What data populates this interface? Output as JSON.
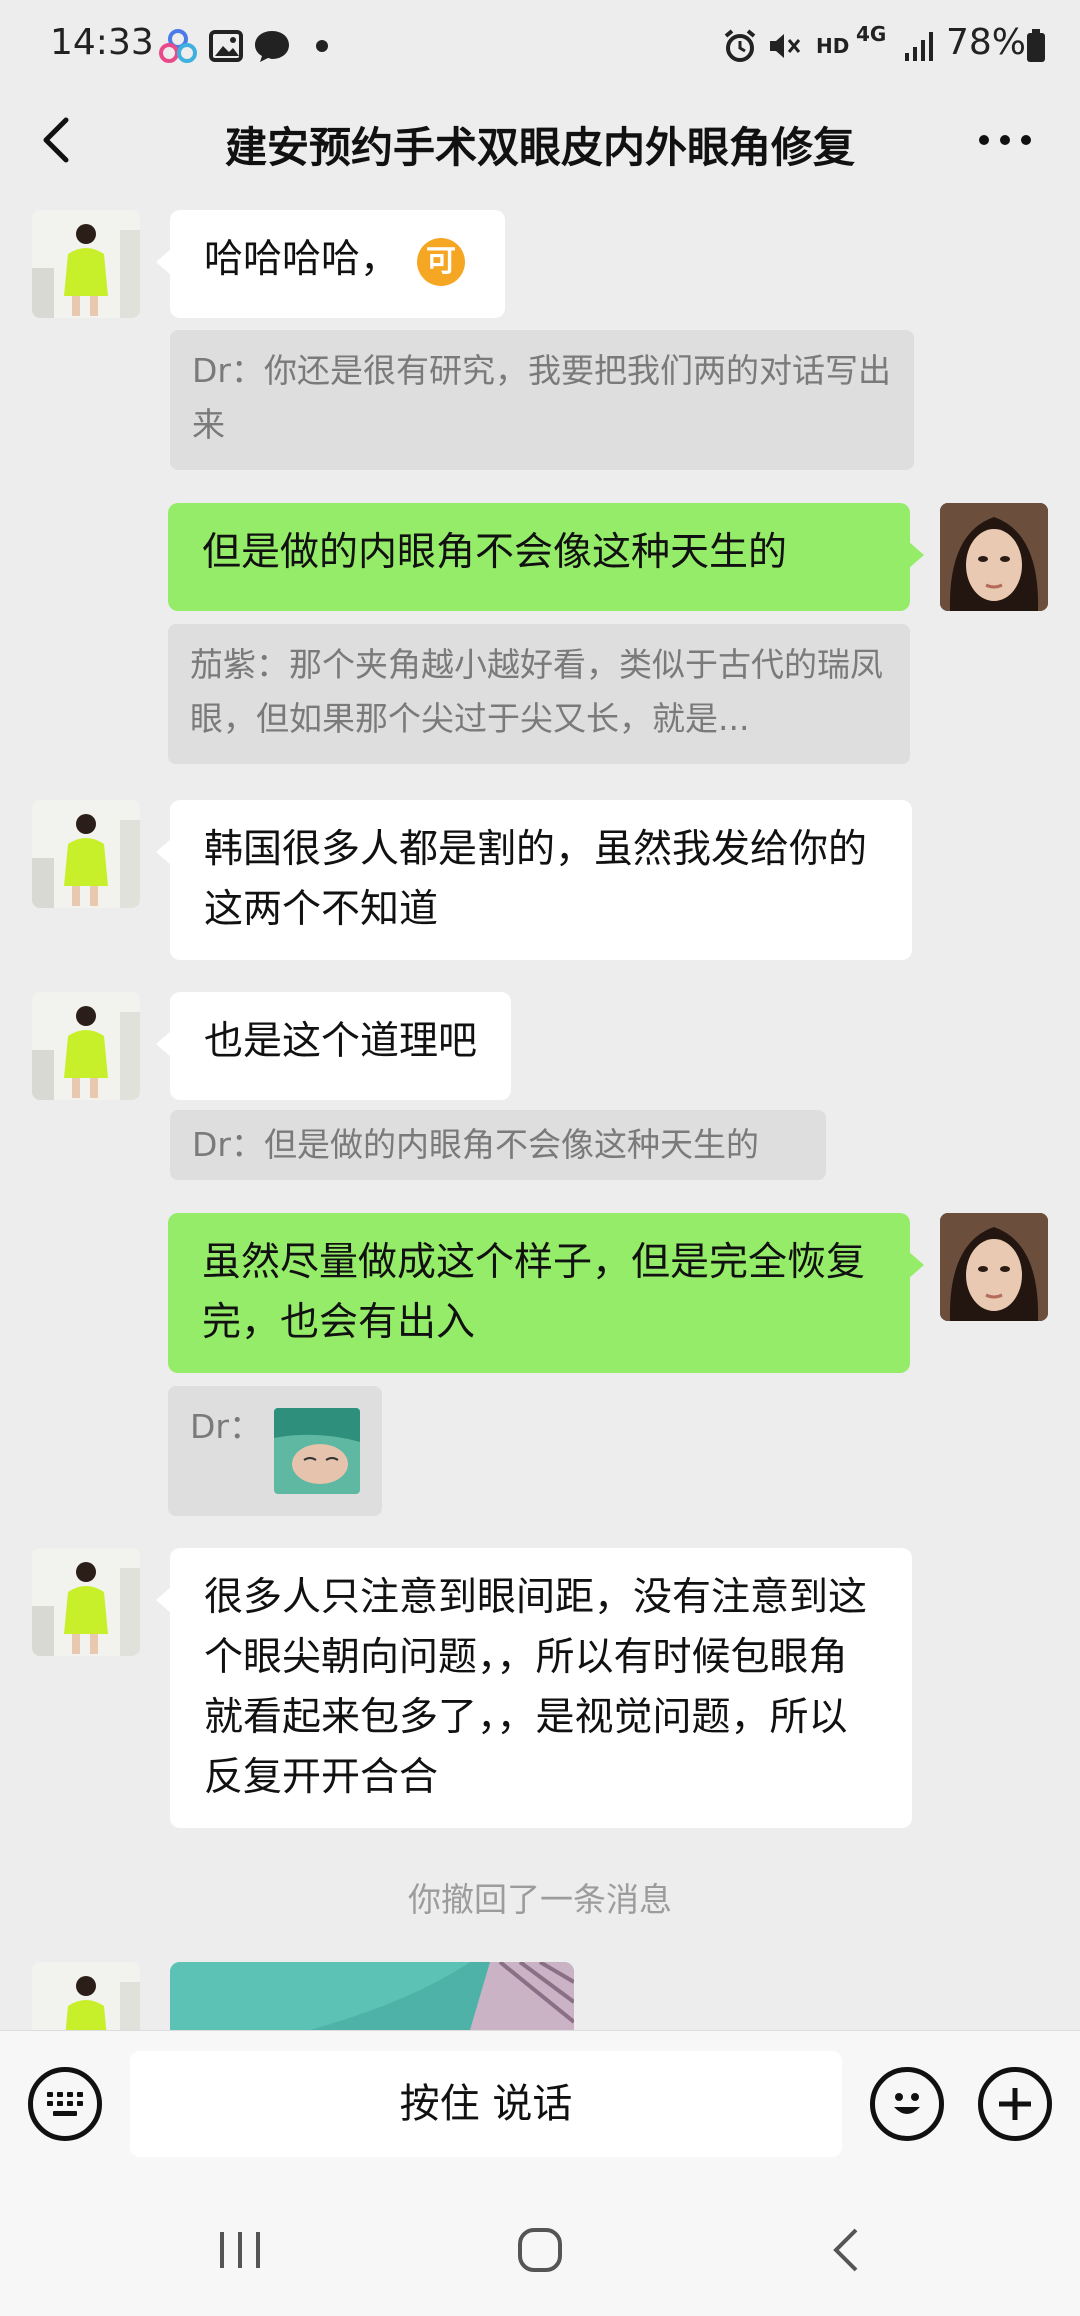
{
  "status_bar": {
    "time": "14:33",
    "network": "4G",
    "network_hd": "HD",
    "battery": "78%"
  },
  "header": {
    "title": "建安预约手术双眼皮内外眼角修复"
  },
  "messages": [
    {
      "side": "left",
      "text": "哈哈哈哈，",
      "emoji": "可"
    },
    {
      "quote": "Dr：你还是很有研究，我要把我们两的对话写出来"
    },
    {
      "side": "right",
      "text": "但是做的内眼角不会像这种天生的"
    },
    {
      "quote": "茄紫：那个夹角越小越好看，类似于古代的瑞凤眼，但如果那个尖过于尖又长，就是..."
    },
    {
      "side": "left",
      "text": "韩国很多人都是割的，虽然我发给你的这两个不知道"
    },
    {
      "side": "left",
      "text": "也是这个道理吧"
    },
    {
      "quote": "Dr：但是做的内眼角不会像这种天生的"
    },
    {
      "side": "right",
      "text": "虽然尽量做成这个样子，但是完全恢复完，也会有出入"
    },
    {
      "quote": "Dr："
    },
    {
      "side": "left",
      "text": "很多人只注意到眼间距，没有注意到这个眼尖朝向问题，，所以有时候包眼角就看起来包多了，，是视觉问题，所以反复开开合合"
    }
  ],
  "system_note": "你撤回了一条消息",
  "input_bar": {
    "hold_to_talk": "按住 说话"
  },
  "colors": {
    "chat_bg": "#ededed",
    "self_bubble": "#95ec69",
    "other_bubble": "#ffffff",
    "emoji_badge": "#f5a623"
  }
}
